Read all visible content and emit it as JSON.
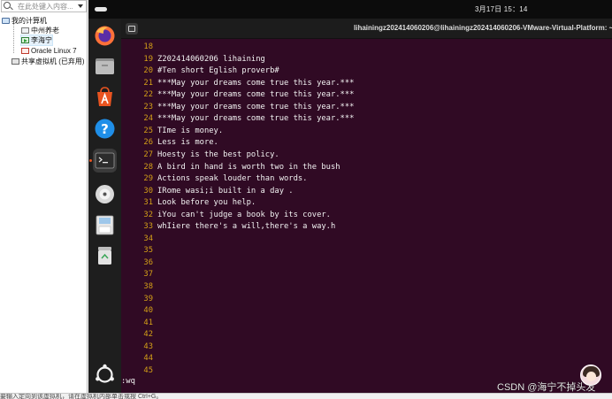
{
  "library": {
    "search_placeholder": "在此处键入内容...",
    "my_computer": "我的计算机",
    "vms": [
      "中州养老",
      "李海宁",
      "Oracle Linux 7"
    ],
    "shared": "共享虚拟机 (已弃用)"
  },
  "guest": {
    "clock": "3月17日  15：14",
    "terminal_title": "lihainingz202414060206@lihainingz202414060206-VMware-Virtual-Platform: ~/liha",
    "dock": [
      "firefox-icon",
      "files-icon",
      "app-center-icon",
      "help-icon",
      "terminal-icon",
      "dvd-icon",
      "save-icon",
      "trash-icon",
      "show-apps-icon"
    ]
  },
  "editor": {
    "lines": [
      {
        "n": "18",
        "t": ""
      },
      {
        "n": "19",
        "t": "Z202414060206 lihaining"
      },
      {
        "n": "20",
        "t": "#Ten short Eglish proverb#"
      },
      {
        "n": "21",
        "t": "***May your dreams come true this year.***"
      },
      {
        "n": "22",
        "t": "***May your dreams come true this year.***"
      },
      {
        "n": "23",
        "t": "***May your dreams come true this year.***"
      },
      {
        "n": "24",
        "t": "***May your dreams come true this year.***"
      },
      {
        "n": "25",
        "t": "TIme is money."
      },
      {
        "n": "26",
        "t": "Less is more."
      },
      {
        "n": "27",
        "t": "Hoesty is the best policy."
      },
      {
        "n": "28",
        "t": "A bird in hand is worth two in the bush"
      },
      {
        "n": "29",
        "t": "Actions speak louder than words."
      },
      {
        "n": "30",
        "t": "IRome wasi;i built in a day ."
      },
      {
        "n": "31",
        "t": "Look before you help."
      },
      {
        "n": "32",
        "t": "iYou can't judge a book by its cover."
      },
      {
        "n": "33",
        "t": "whIiere there's a will,there's a way.h"
      },
      {
        "n": "34",
        "t": ""
      },
      {
        "n": "35",
        "t": ""
      },
      {
        "n": "36",
        "t": ""
      },
      {
        "n": "37",
        "t": ""
      },
      {
        "n": "38",
        "t": ""
      },
      {
        "n": "39",
        "t": ""
      },
      {
        "n": "40",
        "t": ""
      },
      {
        "n": "41",
        "t": ""
      },
      {
        "n": "42",
        "t": ""
      },
      {
        "n": "43",
        "t": ""
      },
      {
        "n": "44",
        "t": ""
      },
      {
        "n": "45",
        "t": ""
      }
    ],
    "command": ":wq"
  },
  "watermark": "CSDN @海宁不掉头发",
  "status_bar": "要输入定向到该虚拟机，请在虚拟机内部单击或按 Ctrl+G。",
  "colors": {
    "terminal_bg": "#300a24",
    "line_number": "#d4a017",
    "dock_bg": "#1e1e1e",
    "accent": "#e95420"
  }
}
